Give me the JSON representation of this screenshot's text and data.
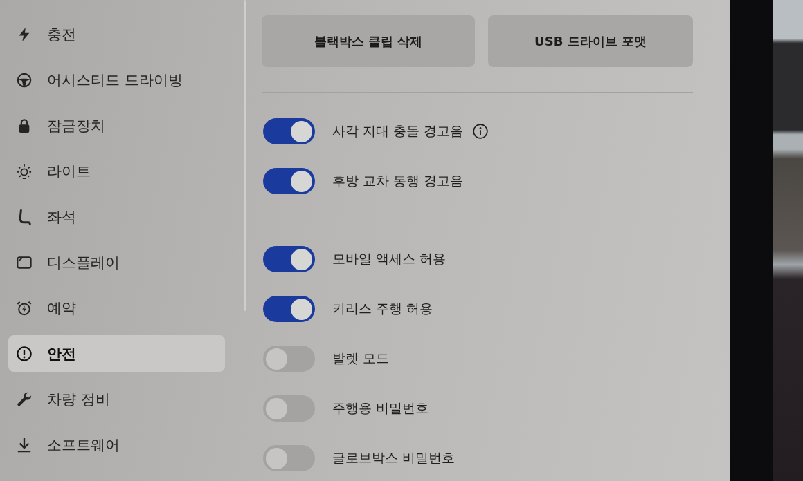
{
  "sidebar": {
    "items": [
      {
        "label": "충전",
        "selected": false
      },
      {
        "label": "어시스티드 드라이빙",
        "selected": false
      },
      {
        "label": "잠금장치",
        "selected": false
      },
      {
        "label": "라이트",
        "selected": false
      },
      {
        "label": "좌석",
        "selected": false
      },
      {
        "label": "디스플레이",
        "selected": false
      },
      {
        "label": "예약",
        "selected": false
      },
      {
        "label": "안전",
        "selected": true
      },
      {
        "label": "차량 정비",
        "selected": false
      },
      {
        "label": "소프트웨어",
        "selected": false
      }
    ]
  },
  "buttons": [
    {
      "label": "블랙박스 클립 삭제"
    },
    {
      "label": "USB 드라이브 포맷"
    }
  ],
  "setting_groups": [
    {
      "toggles": [
        {
          "label": "사각 지대 충돌 경고음",
          "on": true,
          "info": true
        },
        {
          "label": "후방 교차 통행 경고음",
          "on": true,
          "info": false
        }
      ]
    },
    {
      "toggles": [
        {
          "label": "모바일 액세스 허용",
          "on": true,
          "info": false
        },
        {
          "label": "키리스 주행 허용",
          "on": true,
          "info": false
        },
        {
          "label": "발렛 모드",
          "on": false,
          "info": false
        },
        {
          "label": "주행용 비밀번호",
          "on": false,
          "info": false
        },
        {
          "label": "글로브박스 비밀번호",
          "on": false,
          "info": false
        }
      ]
    }
  ]
}
